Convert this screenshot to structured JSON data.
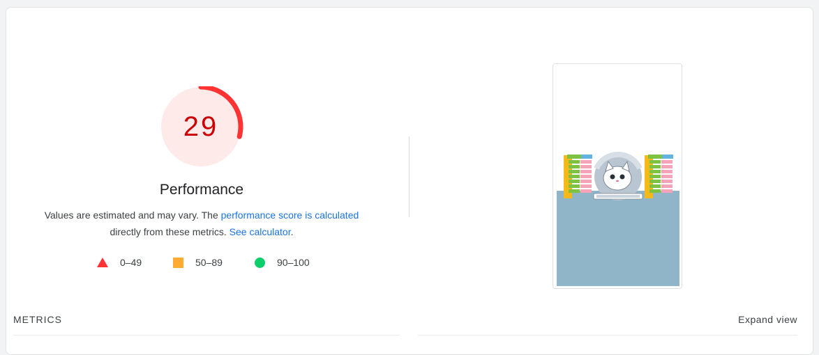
{
  "gauge": {
    "score": "29",
    "score_fraction": 0.29,
    "title": "Performance",
    "fail_color": "#ff3333",
    "fill_color": "#ffeaea",
    "text_color": "#cc0000"
  },
  "description": {
    "prefix": "Values are estimated and may vary. The ",
    "score_link": "performance score is calculated",
    "middle": "directly from these metrics. ",
    "calculator_link": "See calculator",
    "suffix": "."
  },
  "legend": [
    {
      "shape": "triangle-icon",
      "range": "0–49",
      "color": "#ff3333"
    },
    {
      "shape": "square-icon",
      "range": "50–89",
      "color": "#ffaa33"
    },
    {
      "shape": "circle-icon",
      "range": "90–100",
      "color": "#0cce6b"
    }
  ],
  "screenshot": {
    "subject": "page-screenshot-thumbnail"
  },
  "metrics_section": {
    "label": "METRICS",
    "expand_label": "Expand view"
  }
}
